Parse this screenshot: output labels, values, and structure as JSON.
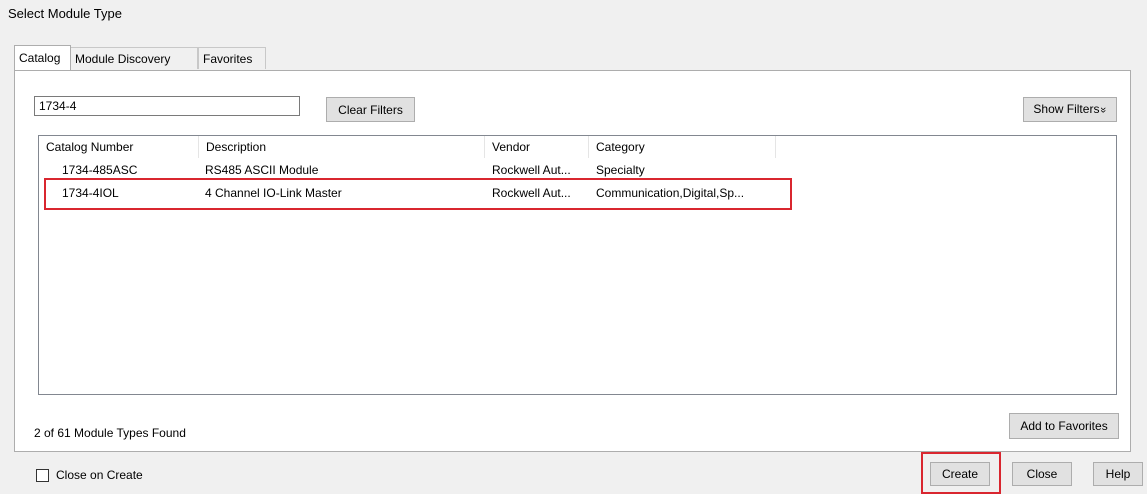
{
  "window": {
    "title": "Select Module Type"
  },
  "tabs": [
    {
      "label": "Catalog",
      "active": true
    },
    {
      "label": "Module Discovery",
      "active": false
    },
    {
      "label": "Favorites",
      "active": false
    }
  ],
  "search": {
    "value": "1734-4"
  },
  "buttons": {
    "clear_filters": "Clear Filters",
    "show_filters": "Show Filters",
    "show_filters_icon": "»",
    "add_to_favorites": "Add to Favorites",
    "create": "Create",
    "close": "Close",
    "help": "Help"
  },
  "table": {
    "columns": [
      "Catalog Number",
      "Description",
      "Vendor",
      "Category"
    ],
    "rows": [
      {
        "catalog": "1734-485ASC",
        "description": "RS485 ASCII Module",
        "vendor": "Rockwell Aut...",
        "category": "Specialty"
      },
      {
        "catalog": "1734-4IOL",
        "description": "4 Channel IO-Link Master",
        "vendor": "Rockwell Aut...",
        "category": "Communication,Digital,Sp..."
      }
    ]
  },
  "status": {
    "found_text": "2 of 61 Module Types Found"
  },
  "footer": {
    "close_on_create_label": "Close on Create",
    "close_on_create_checked": false
  },
  "colors": {
    "highlight": "#d9262f",
    "panel_bg": "#ffffff",
    "window_bg": "#f0f0f0"
  }
}
